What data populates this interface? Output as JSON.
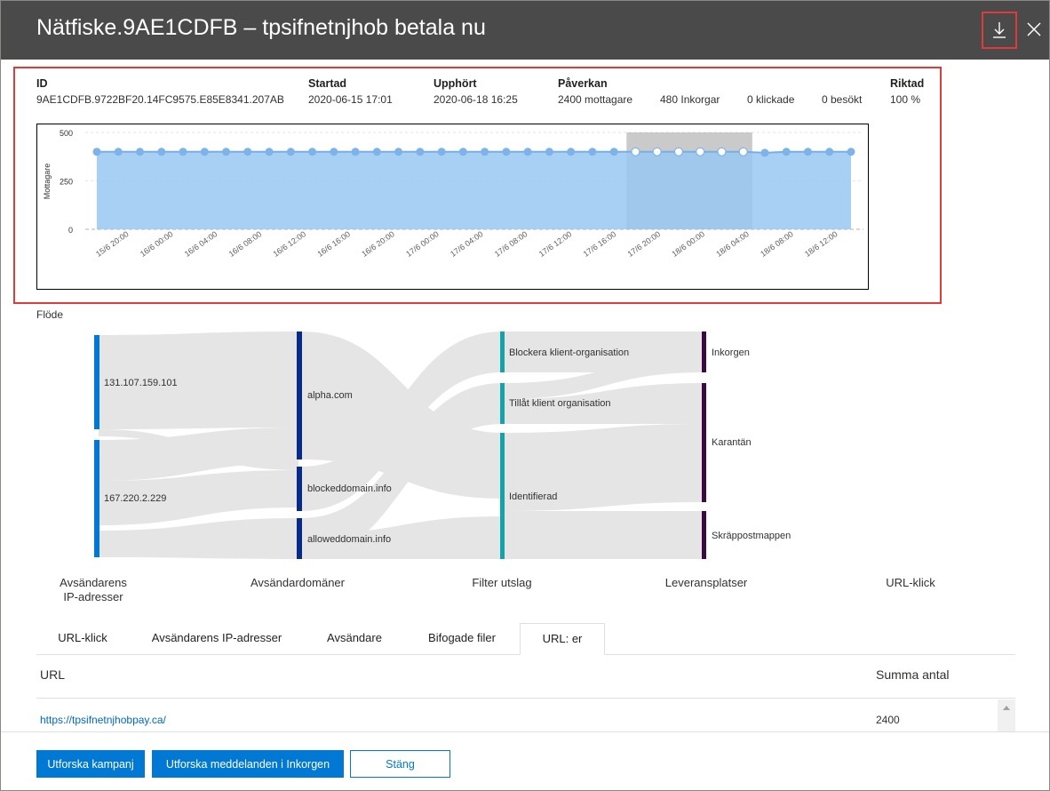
{
  "header": {
    "title": "Nätfiske.9AE1CDFB – tpsifnetnjhob betala nu"
  },
  "details": {
    "id_label": "ID",
    "id_value": "9AE1CDFB.9722BF20.14FC9575.E85E8341.207AB",
    "started_label": "Startad",
    "started_value": "2020-06-15 17:01",
    "ended_label": "Upphört",
    "ended_value": "2020-06-18 16:25",
    "impact_label": "Påverkan",
    "recipients": "2400 mottagare",
    "inbox": "480 Inkorgar",
    "clicked": "0 klickade",
    "visited": "0 besökt",
    "targeted_label": "Riktad",
    "targeted_value": "100 %"
  },
  "chart_data": {
    "type": "area",
    "ylabel": "Mottagare",
    "ylim": [
      0,
      500
    ],
    "yticks": [
      0,
      250,
      500
    ],
    "x": [
      "15/6 20:00",
      "16/6 00:00",
      "16/6 04:00",
      "16/6 08:00",
      "16/6 12:00",
      "16/6 16:00",
      "16/6 20:00",
      "17/6 00:00",
      "17/6 04:00",
      "17/6 08:00",
      "17/6 12:00",
      "17/6 16:00",
      "17/6 20:00",
      "18/6 00:00",
      "18/6 04:00",
      "18/6 08:00",
      "18/6 12:00"
    ],
    "points": [
      400,
      400,
      400,
      400,
      400,
      400,
      400,
      400,
      400,
      400,
      400,
      400,
      400,
      400,
      400,
      400,
      400,
      400,
      400,
      400,
      400,
      400,
      400,
      400,
      400,
      400,
      400,
      400,
      400,
      400,
      400,
      395,
      400,
      400,
      400,
      400
    ],
    "highlight_range_points": [
      25,
      30
    ],
    "color": "#99c7f2",
    "line_color": "#78aee6"
  },
  "flow": {
    "label": "Flöde",
    "columns": [
      "Avsändarens\nIP-adresser",
      "Avsändardomäner",
      "Filter utslag",
      "Leveransplatser",
      "URL-klick"
    ],
    "nodes": {
      "ip1": "131.107.159.101",
      "ip2": "167.220.2.229",
      "d1": "alpha.com",
      "d2": "blockeddomain.info",
      "d3": "alloweddomain.info",
      "f1": "Blockera klient-organisation",
      "f2": "Tillåt klient organisation",
      "f3": "Identifierad",
      "l1": "Inkorgen",
      "l2": "Karantän",
      "l3": "Skräppostmappen"
    },
    "colors": {
      "ip": "#0078d4",
      "domain": "#0a2a88",
      "filter": "#14a3a8",
      "location": "#3b0a45",
      "link": "#e3e3e3"
    }
  },
  "tabs": [
    "URL-klick",
    "Avsändarens IP-adresser",
    "Avsändare",
    "Bifogade filer",
    "URL: er"
  ],
  "table": {
    "col_url": "URL",
    "col_count": "Summa antal",
    "rows": [
      {
        "url": "https://tpsifnetnjhobpay.ca/",
        "count": "2400"
      }
    ]
  },
  "footer": {
    "explore_campaign": "Utforska kampanj",
    "explore_inbox": "Utforska meddelanden i Inkorgen",
    "close": "Stäng"
  }
}
